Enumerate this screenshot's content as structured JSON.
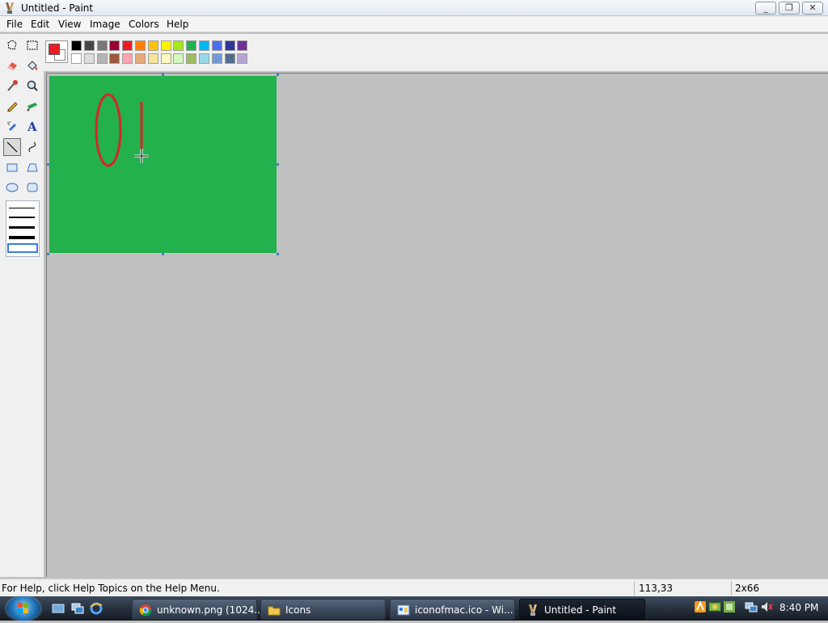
{
  "window": {
    "title": "Untitled - Paint",
    "minimize": "_",
    "maximize": "❐",
    "close": "✕"
  },
  "menu": [
    "File",
    "Edit",
    "View",
    "Image",
    "Colors",
    "Help"
  ],
  "tools": [
    "free-form-select",
    "select",
    "eraser",
    "fill-with-color",
    "pick-color",
    "magnifier",
    "pencil",
    "brush",
    "airbrush",
    "text",
    "line",
    "curve",
    "rectangle",
    "polygon",
    "ellipse",
    "rounded-rectangle"
  ],
  "selected_tool": "line",
  "colors": {
    "foreground": "#ed1c24",
    "background": "#ffffff",
    "canvas": "#22b14c",
    "stroke": "#d6252a",
    "palette_row1": [
      "#000000",
      "#464646",
      "#787878",
      "#990030",
      "#ed1c24",
      "#ff7e00",
      "#ffc20e",
      "#fff200",
      "#a8e61d",
      "#22b14c",
      "#00b7ef",
      "#4d6df3",
      "#2f3699",
      "#6f3198"
    ],
    "palette_row2": [
      "#ffffff",
      "#dcdcdc",
      "#b4b4b4",
      "#9c5a3c",
      "#ffa3b1",
      "#e5aa7a",
      "#f5e49c",
      "#fff9bd",
      "#d3f9bc",
      "#9dbb61",
      "#99d9ea",
      "#709ad1",
      "#546d8e",
      "#b5a5d5"
    ]
  },
  "status": {
    "help": "For Help, click Help Topics on the Help Menu.",
    "coords": "113,33",
    "size": "2x66"
  },
  "taskbar": {
    "buttons": [
      {
        "label": "unknown.png (1024...",
        "icon": "chrome-icon"
      },
      {
        "label": "Icons",
        "icon": "folder-icon"
      },
      {
        "label": "iconofmac.ico - Wi...",
        "icon": "image-viewer-icon"
      },
      {
        "label": "Untitled - Paint",
        "icon": "paint-icon",
        "active": true
      }
    ],
    "clock": "8:40 PM"
  }
}
